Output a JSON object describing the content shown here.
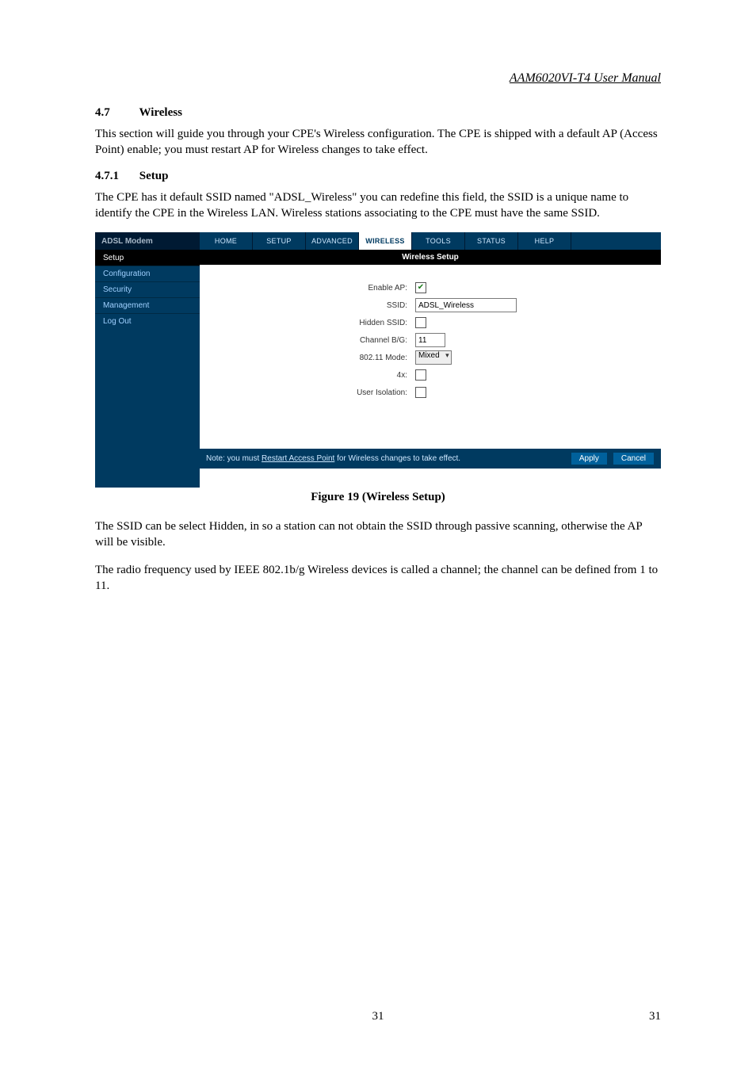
{
  "header": {
    "title": "AAM6020VI-T4 User Manual"
  },
  "sec47": {
    "number": "4.7",
    "title": "Wireless",
    "para": "This section will guide you through your CPE's Wireless configuration.   The CPE is shipped with a default AP (Access Point) enable; you must restart AP for Wireless changes to take effect."
  },
  "sec471": {
    "number": "4.7.1",
    "title": "Setup",
    "para": "The CPE has it default SSID named \"ADSL_Wireless\" you can redefine this field, the SSID is a unique name to identify the CPE in the Wireless LAN. Wireless stations associating to the CPE must have the same SSID."
  },
  "router": {
    "brand": "ADSL Modem",
    "tabs": [
      "HOME",
      "SETUP",
      "ADVANCED",
      "WIRELESS",
      "TOOLS",
      "STATUS",
      "HELP"
    ],
    "active_tab": "WIRELESS",
    "side": [
      "Setup",
      "Configuration",
      "Security",
      "Management",
      "Log Out"
    ],
    "side_active": "Setup",
    "main_title": "Wireless Setup",
    "form": {
      "enable_ap_label": "Enable AP:",
      "enable_ap_checked": "✔",
      "ssid_label": "SSID:",
      "ssid_value": "ADSL_Wireless",
      "hidden_ssid_label": "Hidden SSID:",
      "hidden_ssid_checked": "",
      "channel_label": "Channel B/G:",
      "channel_value": "11",
      "mode_label": "802.11 Mode:",
      "mode_value": "Mixed",
      "fourx_label": "4x:",
      "fourx_checked": "",
      "user_iso_label": "User Isolation:",
      "user_iso_checked": ""
    },
    "footer": {
      "note_before": "Note: you must ",
      "note_link": "Restart Access Point",
      "note_after": " for Wireless changes to take effect.",
      "apply": "Apply",
      "cancel": "Cancel"
    }
  },
  "figure_caption": "Figure 19 (Wireless Setup)",
  "after": {
    "p1": "The SSID can be select Hidden, in so a station can not obtain the SSID through passive scanning, otherwise the AP will be visible.",
    "p2": "The radio frequency used by IEEE 802.1b/g Wireless devices is called a channel; the channel can be defined from 1 to 11."
  },
  "page_number_center": "31",
  "page_number_right": "31"
}
